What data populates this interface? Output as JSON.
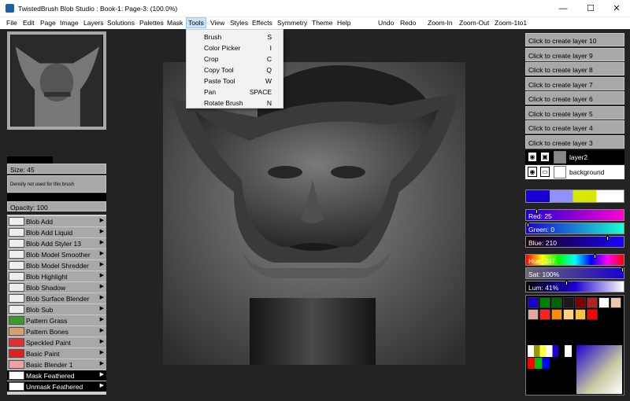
{
  "window": {
    "title": "TwistedBrush Blob Studio : Book-1: Page-3:  (100.0%)",
    "minimize_label": "—",
    "maximize_label": "☐",
    "close_label": "✕"
  },
  "menu": {
    "items": [
      "File",
      "Edit",
      "Page",
      "Image",
      "Layers",
      "Solutions",
      "Palettes",
      "Mask",
      "Tools",
      "View",
      "Styles",
      "Effects",
      "Symmetry",
      "Theme",
      "Help"
    ],
    "actions": [
      "Undo",
      "Redo",
      "Zoom-In",
      "Zoom-Out",
      "Zoom-1to1"
    ],
    "active": "Tools"
  },
  "tools_menu": [
    {
      "label": "Brush",
      "key": "S"
    },
    {
      "label": "Color Picker",
      "key": "I"
    },
    {
      "label": "Crop",
      "key": "C"
    },
    {
      "label": "Copy Tool",
      "key": "Q"
    },
    {
      "label": "Paste Tool",
      "key": "W"
    },
    {
      "label": "Pan",
      "key": "SPACE"
    },
    {
      "label": "Rotate Brush",
      "key": "N"
    }
  ],
  "brush_settings": {
    "size": "Size: 45",
    "density": "Density not used for this brush",
    "opacity": "Opacity: 100"
  },
  "brushes": [
    "Blob Add",
    "Blob Add Liquid",
    "Blob Add Styler 13",
    "Blob Model Smoother",
    "Blob Model Shredder",
    "Blob Highlight",
    "Blob Shadow",
    "Blob Surface Blender",
    "Blob Sub",
    "Pattern Grass",
    "Pattern Bones",
    "Speckled Paint",
    "Basic Paint",
    "Basic Blender 1",
    "Mask Feathered",
    "Unmask Feathered"
  ],
  "selected_brush": "Mask Feathered",
  "layers": {
    "create_buttons": [
      "Click to create layer 10",
      "Click to create layer 9",
      "Click to create layer 8",
      "Click to create layer 7",
      "Click to create layer 6",
      "Click to create layer 5",
      "Click to create layer 4",
      "Click to create layer 3"
    ],
    "rows": [
      {
        "name": "layer2",
        "selected": true
      },
      {
        "name": "background",
        "selected": false
      }
    ]
  },
  "color": {
    "red": "Red: 25",
    "green": "Green: 0",
    "blue": "Blue: 210",
    "hue": "Hue: 247",
    "sat": "Sat: 100%",
    "lum": "Lum: 41%",
    "current": "#1900d2"
  },
  "palette_colors": [
    "#1900d2",
    "#008000",
    "#006400",
    "#1a1a1a",
    "#800000",
    "#b22222",
    "#ffffff",
    "#e8c8b0",
    "#e0a8a0",
    "#ff2020",
    "#ff8c00",
    "#ffd080",
    "#ffc040",
    "#ff0000"
  ]
}
